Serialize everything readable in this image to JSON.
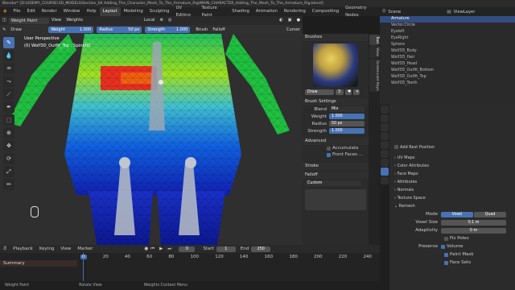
{
  "window_title": "Blender* [D:\\UDEMY_COURSE\\3D_MODELS\\Section_04 Adding_The_Character_Mesh_To_The_Armature_Rig\\MAIN_CHARACTER_Adding_The_Mesh_To_The_Armature_Rig.blend]",
  "menu": [
    "File",
    "Edit",
    "Render",
    "Window",
    "Help"
  ],
  "workspaces": [
    "Layout",
    "Modeling",
    "Sculpting",
    "UV Editing",
    "Texture Paint",
    "Shading",
    "Animation",
    "Rendering",
    "Compositing",
    "Geometry Nodes"
  ],
  "active_workspace": "Layout",
  "scene": {
    "label": "Scene",
    "view_layer": "ViewLayer"
  },
  "header": {
    "mode": "Weight Paint",
    "view": "View",
    "weights": "Weights",
    "orientation": "Local",
    "snap_label": "Brush",
    "falloff": "Falloff",
    "cursor": "Cursor"
  },
  "tool_settings": {
    "brush": "Draw",
    "weight_label": "Weight",
    "weight_value": "1.000",
    "radius_label": "Radius",
    "radius_value": "50 px",
    "strength_label": "Strength",
    "strength_value": "1.000"
  },
  "viewport": {
    "perspective": "User Perspective",
    "object_info": "(0) Wolf3D_Outfit_Top : Spine02"
  },
  "npanel": {
    "brushes_title": "Brushes",
    "brush_name": "Draw",
    "brush_users": "3",
    "brush_settings_title": "Brush Settings",
    "blend_label": "Blend",
    "blend_value": "Mix",
    "weight_label": "Weight",
    "weight_value": "1.000",
    "radius_label": "Radius",
    "radius_value": "50 px",
    "strength_label": "Strength",
    "strength_value": "1.000",
    "advanced_title": "Advanced",
    "accumulate": "Accumulate",
    "front_faces": "Front Faces ...",
    "stroke_title": "Stroke",
    "falloff_title": "Falloff",
    "falloff_preset": "Custom"
  },
  "vertical_tabs": [
    "Tool",
    "View",
    "Screencast Keys"
  ],
  "outliner": {
    "items": [
      "Armature",
      "Vector.Circle",
      "Eyeleft",
      "EyeRight",
      "Sphere",
      "Wolf3D_Body",
      "Wolf3D_Hair",
      "Wolf3D_Head",
      "Wolf3D_Outfit_Bottom",
      "Wolf3D_Outfit_Top",
      "Wolf3D_Teeth"
    ],
    "selected_index": 0
  },
  "properties": {
    "add_rest_position": "Add Rest Position",
    "sections": [
      "UV Maps",
      "Color Attributes",
      "Face Maps",
      "Attributes",
      "Normals",
      "Texture Space",
      "Remesh"
    ],
    "remesh": {
      "mode_label": "Mode",
      "mode_voxel": "Voxel",
      "mode_quad": "Quad",
      "voxel_size_label": "Voxel Size",
      "voxel_size_value": "0.1 m",
      "adaptivity_label": "Adaptivity",
      "adaptivity_value": "0 m",
      "fix_poles": "Fix Poles",
      "preserve_label": "Preserve",
      "preserve_volume": "Volume",
      "preserve_paint_mask": "Paint Mask",
      "preserve_face_sets": "Face Sets"
    }
  },
  "timeline": {
    "menus": [
      "Playback",
      "Keying",
      "View",
      "Marker"
    ],
    "current_frame": "0",
    "start_label": "Start",
    "start_value": "1",
    "end_label": "End",
    "end_value": "250",
    "ticks": [
      "0",
      "20",
      "40",
      "60",
      "80",
      "100",
      "120",
      "140",
      "160",
      "180",
      "200",
      "220",
      "240"
    ],
    "summary": "Summary"
  },
  "status": {
    "left": "Weight Paint",
    "middle": "Rotate View",
    "right": "Weights Context Menu"
  },
  "colors": {
    "accent": "#4772b3",
    "selection": "#334d80"
  }
}
